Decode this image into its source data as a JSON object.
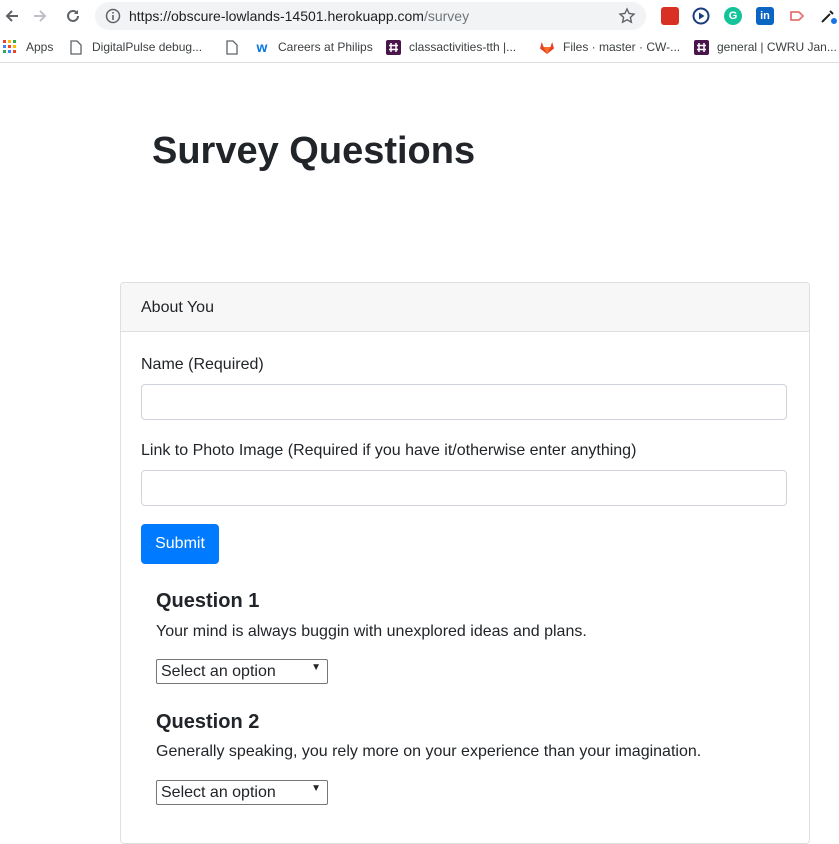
{
  "browser": {
    "url_host": "https://obscure-lowlands-14501.herokuapp.com",
    "url_path": "/survey"
  },
  "bookmarks": [
    {
      "label": "Apps",
      "icon": "apps-grid-icon"
    },
    {
      "label": "DigitalPulse debug...",
      "icon": "page-icon"
    },
    {
      "label": "Careers at Philips",
      "icon": "workday-icon"
    },
    {
      "label": "classactivities-tth |...",
      "icon": "slack-icon"
    },
    {
      "label": "Files · master · CW-...",
      "icon": "gitlab-icon"
    },
    {
      "label": "general | CWRU Jan...",
      "icon": "slack-icon"
    }
  ],
  "page": {
    "title": "Survey Questions",
    "card_header": "About You",
    "name_label": "Name (Required)",
    "name_value": "",
    "photo_label": "Link to Photo Image (Required if you have it/otherwise enter anything)",
    "photo_value": "",
    "submit_label": "Submit"
  },
  "questions": [
    {
      "title": "Question 1",
      "text": "Your mind is always buggin with unexplored ideas and plans.",
      "selected": "Select an option"
    },
    {
      "title": "Question 2",
      "text": "Generally speaking, you rely more on your experience than your imagination.",
      "selected": "Select an option"
    }
  ],
  "colors": {
    "primary": "#007bff",
    "card_header_bg": "#f7f7f7"
  }
}
